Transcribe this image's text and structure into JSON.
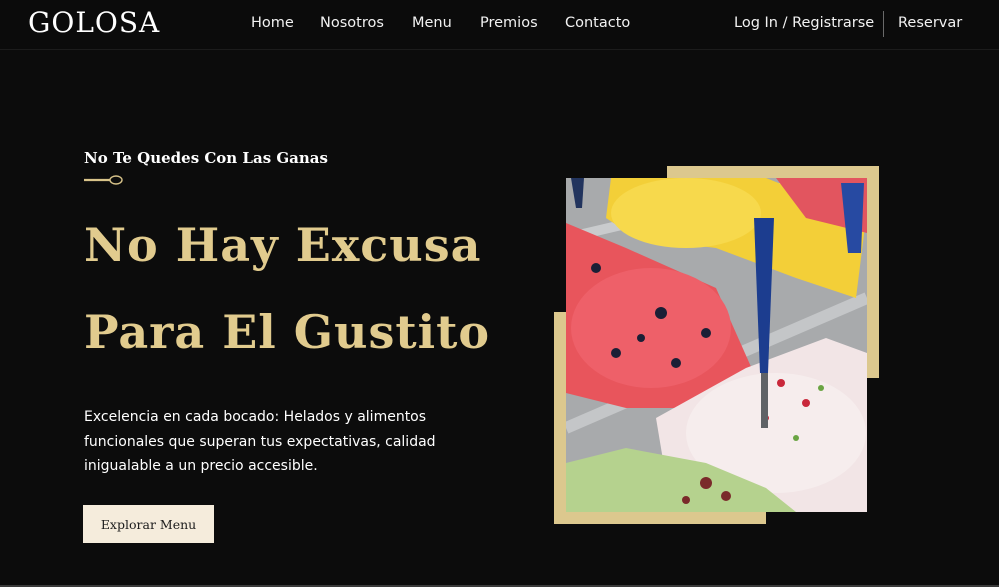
{
  "brand": {
    "logo": "GOLOSA"
  },
  "nav": {
    "home": "Home",
    "about": "Nosotros",
    "menu": "Menu",
    "awards": "Premios",
    "contact": "Contacto",
    "login": "Log In / Registrarse",
    "reserve": "Reservar"
  },
  "hero": {
    "eyebrow": "No Te Quedes Con Las Ganas",
    "title_line1": "No Hay Excusa",
    "title_line2": "Para El Gustito",
    "description": "Excelencia en cada bocado: Helados y alimentos funcionales que superan tus expectativas, calidad inigualable a un precio accesible.",
    "cta": "Explorar Menu"
  },
  "colors": {
    "accent_gold": "#e1cb8e",
    "frame_gold": "#dcc88e",
    "background": "#0c0c0c",
    "button_bg": "#f5ecdc"
  },
  "icons": {
    "divider": "spoon-icon"
  }
}
